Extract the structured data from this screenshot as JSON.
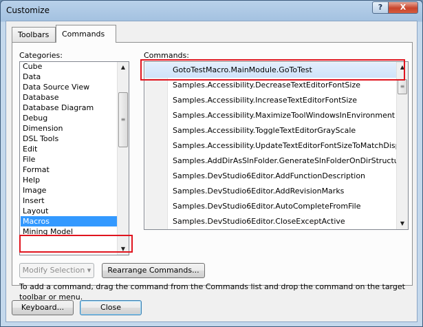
{
  "window": {
    "title": "Customize",
    "help_glyph": "?",
    "close_glyph": "X"
  },
  "tabs": [
    {
      "label": "Toolbars",
      "selected": false
    },
    {
      "label": "Commands",
      "selected": true
    }
  ],
  "categories": {
    "label": "Categories:",
    "items": [
      "Cube",
      "Data",
      "Data Source View",
      "Database",
      "Database Diagram",
      "Debug",
      "Dimension",
      "DSL Tools",
      "Edit",
      "File",
      "Format",
      "Help",
      "Image",
      "Insert",
      "Layout",
      "Macros",
      "Mining Model"
    ],
    "selected": "Macros"
  },
  "commands": {
    "label": "Commands:",
    "items": [
      "GotoTestMacro.MainModule.GoToTest",
      "Samples.Accessibility.DecreaseTextEditorFontSize",
      "Samples.Accessibility.IncreaseTextEditorFontSize",
      "Samples.Accessibility.MaximizeToolWindowsInEnvironment",
      "Samples.Accessibility.ToggleTextEditorGrayScale",
      "Samples.Accessibility.UpdateTextEditorFontSizeToMatchDisp",
      "Samples.AddDirAsSlnFolder.GenerateSlnFolderOnDirStructure",
      "Samples.DevStudio6Editor.AddFunctionDescription",
      "Samples.DevStudio6Editor.AddRevisionMarks",
      "Samples.DevStudio6Editor.AutoCompleteFromFile",
      "Samples.DevStudio6Editor.CloseExceptActive"
    ],
    "selected": "GotoTestMacro.MainModule.GoToTest"
  },
  "buttons": {
    "modify_selection": "Modify Selection",
    "dropdown_glyph": "▾",
    "rearrange": "Rearrange Commands...",
    "keyboard": "Keyboard...",
    "close": "Close"
  },
  "help_text": "To add a command, drag the command from the Commands list and drop the command on the target toolbar or menu.",
  "colors": {
    "selection": "#3399ff",
    "highlight_box": "#e0141e"
  }
}
